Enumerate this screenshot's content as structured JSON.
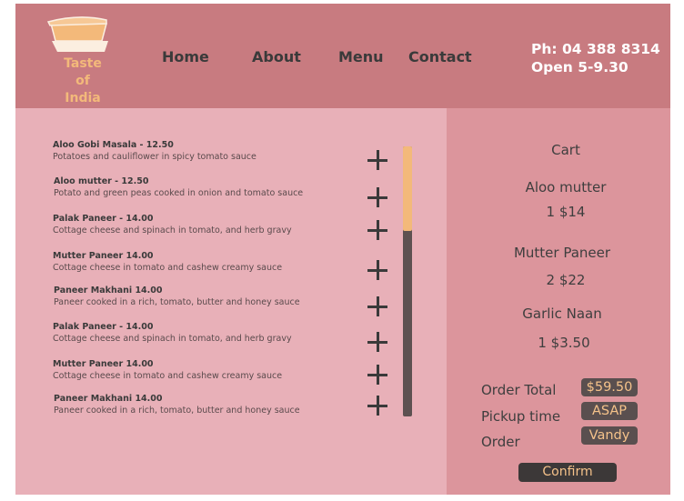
{
  "brand": {
    "logo_icon": "food-container-icon",
    "line1": "Taste",
    "line2": "of",
    "line3": "India"
  },
  "nav": [
    {
      "label": "Home"
    },
    {
      "label": "About"
    },
    {
      "label": "Menu"
    },
    {
      "label": "Contact"
    }
  ],
  "contact": {
    "phone": "Ph: 04 388 8314",
    "hours": "Open 5-9.30"
  },
  "menu_items": [
    {
      "title": "Aloo Gobi Masala - 12.50",
      "desc": "Potatoes and cauliflower in spicy tomato sauce"
    },
    {
      "title": "Aloo mutter - 12.50",
      "desc": "Potato and green peas cooked in onion and tomato sauce"
    },
    {
      "title": "Palak Paneer - 14.00",
      "desc": "Cottage cheese and spinach in tomato, and herb gravy"
    },
    {
      "title": "Mutter Paneer 14.00",
      "desc": "Cottage cheese in tomato and cashew creamy sauce"
    },
    {
      "title": "Paneer Makhani 14.00",
      "desc": "Paneer cooked in a rich, tomato, butter and honey sauce"
    },
    {
      "title": "Palak Paneer - 14.00",
      "desc": "Cottage cheese and spinach in tomato, and herb gravy"
    },
    {
      "title": "Mutter Paneer 14.00",
      "desc": "Cottage cheese in tomato and cashew creamy sauce"
    },
    {
      "title": "Paneer Makhani 14.00",
      "desc": "Paneer cooked in a rich, tomato, butter and honey sauce"
    }
  ],
  "add_icon": "plus-icon",
  "cart": {
    "title": "Cart",
    "items": [
      {
        "name": "Aloo mutter",
        "qty_price": "1 $14"
      },
      {
        "name": "Mutter Paneer",
        "qty_price": "2 $22"
      },
      {
        "name": "Garlic Naan",
        "qty_price": "1 $3.50"
      }
    ],
    "order_total_label": "Order Total",
    "order_total_value": "$59.50",
    "pickup_label": "Pickup time",
    "pickup_value": "ASAP",
    "order_label": "Order",
    "order_value": "Vandy",
    "confirm_label": "Confirm"
  },
  "colors": {
    "header": "#c87b80",
    "menu_panel": "#e8b0b8",
    "cart_panel": "#dc959c",
    "accent": "#f3b97a",
    "dark": "#3c3838"
  }
}
